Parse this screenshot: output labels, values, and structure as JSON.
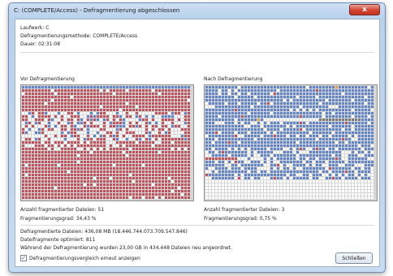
{
  "window": {
    "title": "C: (COMPLETE/Access) - Defragmentierung abgeschlossen",
    "close_glyph": "x"
  },
  "info": {
    "drive": "Laufwerk: C",
    "method": "Defragmentierungsmethode: COMPLETE/Access",
    "duration": "Dauer: 02:31:08"
  },
  "before": {
    "label": "Vor Defragmentierung",
    "fragmented_files": "Anzahl fragmentierter Dateien:  51",
    "fragmentation": "Fragmentierungsgrad: 34,43 %"
  },
  "after": {
    "label": "Nach Defragmentierung",
    "fragmented_files": "Anzahl fragmentierter Dateien:  3",
    "fragmentation": "Fragmentierungsgrad: 0,75 %"
  },
  "summary": {
    "defragmented": "Defragmentierte Dateien: 436,08 MB (18.446.744.073.709.547.846)",
    "optimized": "Dateifragmente optimiert: 811",
    "moved": "Während der Defragmentierung wurden 23,00 GB in 434.448 Dateien neu angeordnet."
  },
  "footer": {
    "checkbox_label": "Defragmentierungsvergleich erneut anzeigen",
    "checkbox_checked": true,
    "checkbox_glyph": "✓",
    "close_button": "Schließen"
  },
  "colors": {
    "fragmented": "#c0505a",
    "contiguous": "#5f83c8",
    "free": "#ffffff",
    "system": "#7a7a7a",
    "highlight": "#e8a13a"
  }
}
